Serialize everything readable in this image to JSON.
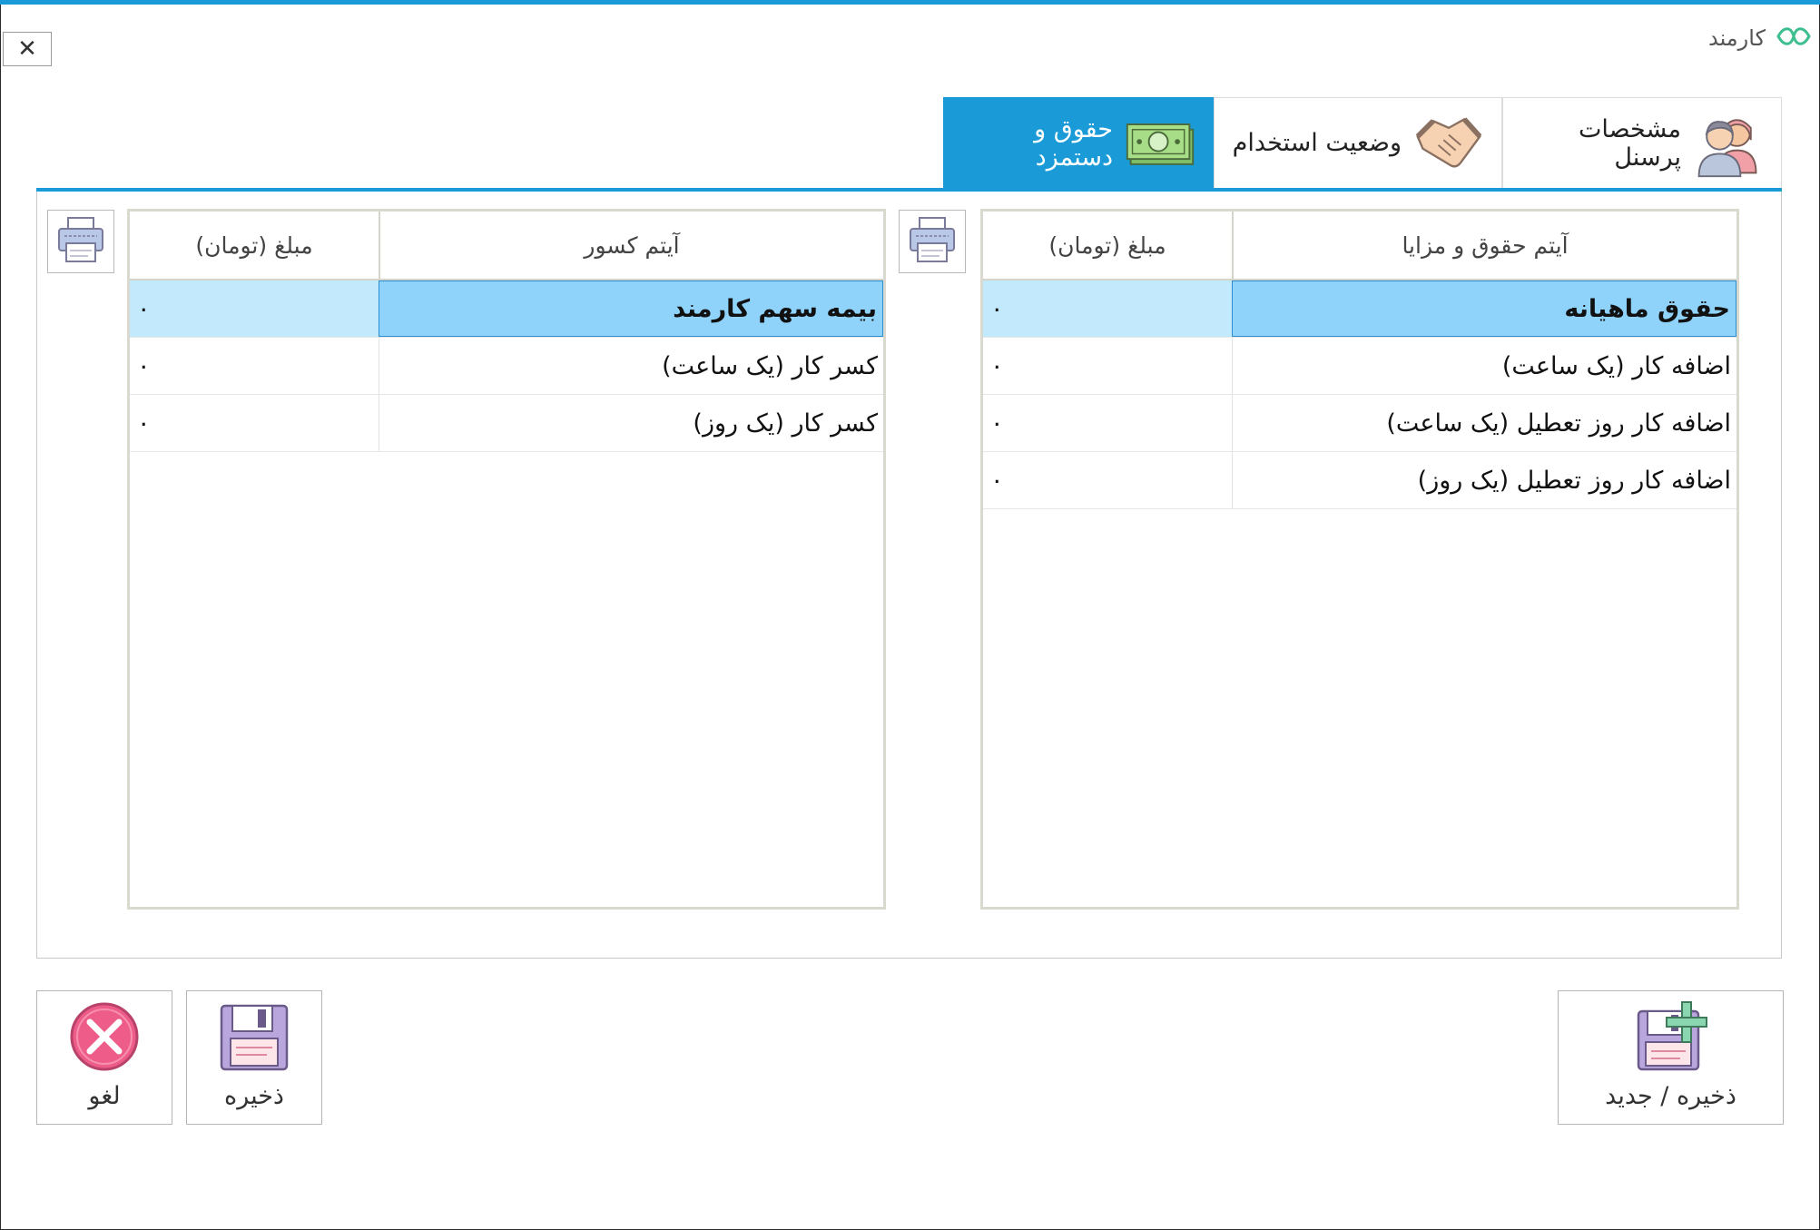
{
  "window": {
    "title": "کارمند",
    "close_symbol": "✕",
    "accent_color": "#1a9bd7"
  },
  "tabs": [
    {
      "label": "مشخصات پرسنل",
      "icon": "personnel-icon",
      "active": false
    },
    {
      "label": "وضعیت استخدام",
      "icon": "handshake-icon",
      "active": false
    },
    {
      "label": "حقوق و دستمزد",
      "icon": "money-icon",
      "active": true
    }
  ],
  "benefits_grid": {
    "columns": [
      "آیتم حقوق و مزایا",
      "مبلغ (تومان)"
    ],
    "rows": [
      {
        "item": "حقوق ماهیانه",
        "amount": "۰",
        "selected": true
      },
      {
        "item": "اضافه کار (یک ساعت)",
        "amount": "۰"
      },
      {
        "item": "اضافه کار روز تعطیل (یک ساعت)",
        "amount": "۰"
      },
      {
        "item": "اضافه کار روز تعطیل (یک روز)",
        "amount": "۰"
      }
    ]
  },
  "deductions_grid": {
    "columns": [
      "آیتم کسور",
      "مبلغ (تومان)"
    ],
    "rows": [
      {
        "item": "بیمه سهم کارمند",
        "amount": "۰",
        "selected": true
      },
      {
        "item": "کسر کار (یک ساعت)",
        "amount": "۰"
      },
      {
        "item": "کسر کار (یک روز)",
        "amount": "۰"
      }
    ]
  },
  "buttons": {
    "save_new": "ذخیره / جدید",
    "save": "ذخیره",
    "cancel": "لغو"
  }
}
